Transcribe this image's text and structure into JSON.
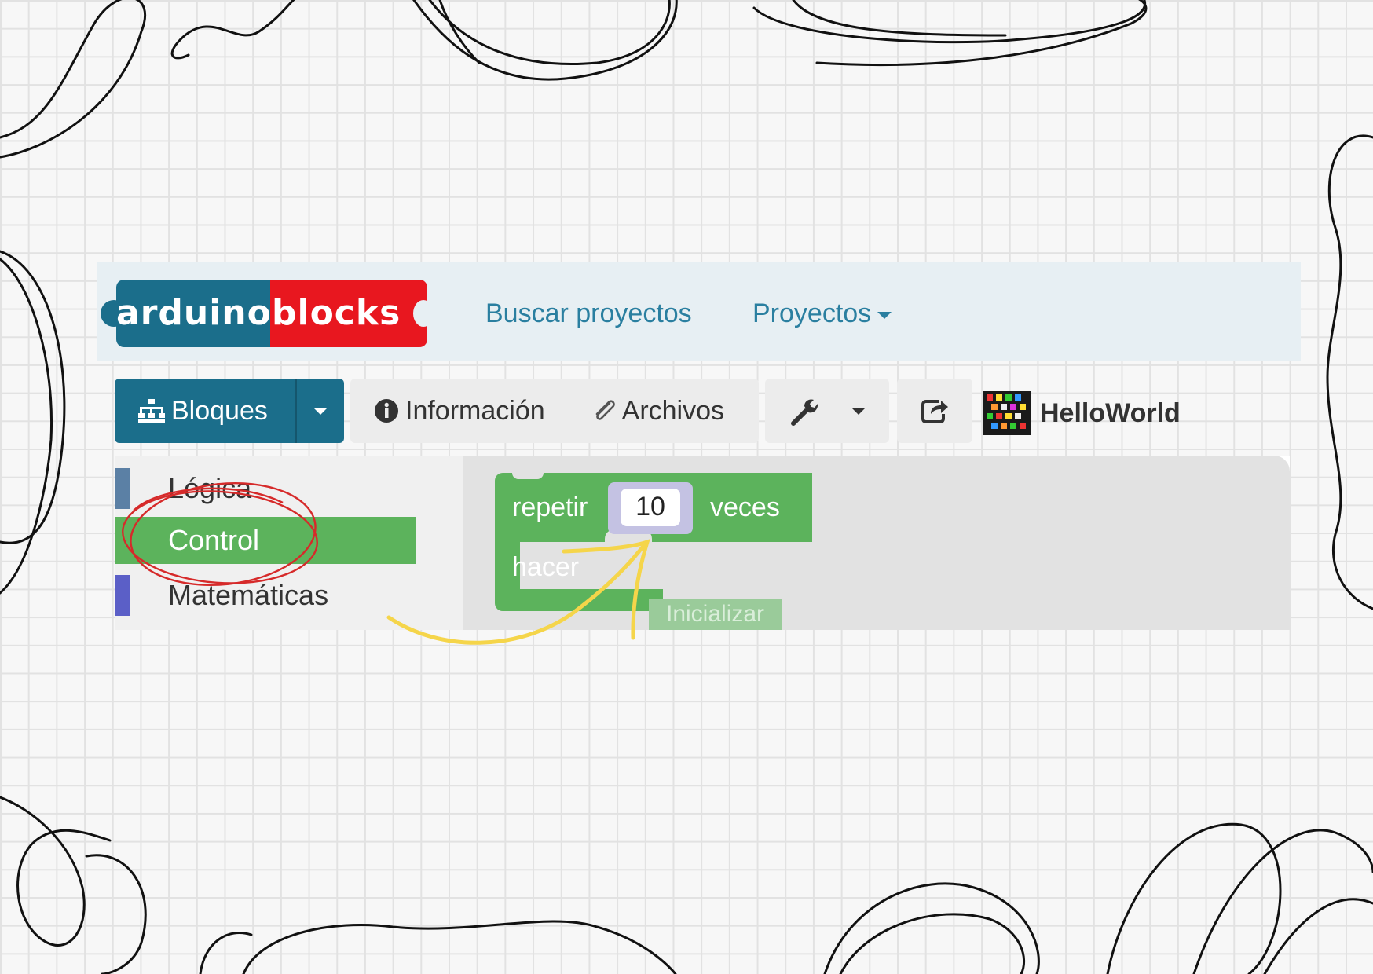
{
  "navbar": {
    "logo_left": "arduino",
    "logo_right": "blocks",
    "links": [
      "Buscar proyectos",
      "Proyectos"
    ]
  },
  "toolbar": {
    "bloques_label": "Bloques",
    "informacion_label": "Información",
    "archivos_label": "Archivos",
    "project_name": "HelloWorld"
  },
  "toolbox": {
    "categories": [
      {
        "label": "Lógica",
        "color": "#5b80a5"
      },
      {
        "label": "Control",
        "color": "#5cb35c"
      },
      {
        "label": "Matemáticas",
        "color": "#5b5fc7"
      }
    ]
  },
  "block": {
    "repeat_label": "repetir",
    "count": "10",
    "times_label": "veces",
    "do_label": "hacer",
    "ghost_label": "Inicializar"
  },
  "colors": {
    "brand_blue": "#1b6e8b",
    "brand_red": "#e8171f",
    "block_green": "#5cb35c",
    "annotation_red": "#d62a2a",
    "annotation_yellow": "#f5d54a"
  }
}
